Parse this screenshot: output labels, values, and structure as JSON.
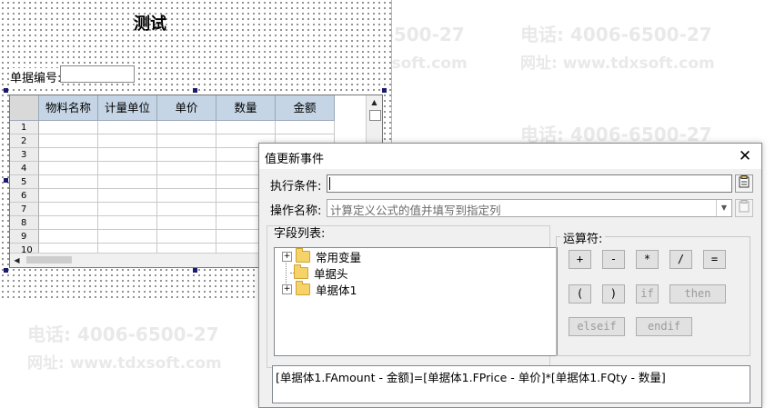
{
  "watermark": {
    "phone": "电话: 4006-6500-27",
    "website": "网址: www.tdxsoft.com"
  },
  "designer": {
    "title": "测试",
    "bill_no_label": "单据编号:",
    "bill_no_value": "",
    "grid": {
      "columns": [
        "物料名称",
        "计量单位",
        "单价",
        "数量",
        "金额"
      ],
      "row_numbers": [
        "1",
        "2",
        "3",
        "4",
        "5",
        "6",
        "7",
        "8",
        "9",
        "10"
      ]
    }
  },
  "dialog": {
    "title": "值更新事件",
    "close_glyph": "✕",
    "condition_label": "执行条件:",
    "condition_value": "",
    "operation_label": "操作名称:",
    "operation_value": "计算定义公式的值并填写到指定列",
    "fields_label": "字段列表:",
    "tree": [
      {
        "label": "常用变量",
        "expandable": true,
        "expand_glyph": "+"
      },
      {
        "label": "单据头",
        "expandable": false
      },
      {
        "label": "单据体1",
        "expandable": true,
        "expand_glyph": "+"
      }
    ],
    "operators_label": "运算符:",
    "operators": [
      "+",
      "-",
      "*",
      "/",
      "=",
      "(",
      ")",
      "if",
      "then",
      "elseif",
      "endif"
    ],
    "formula": "[单据体1.FAmount - 金额]=[单据体1.FPrice - 单价]*[单据体1.FQty - 数量]",
    "icons": [
      "clipboard-icon",
      "clipboard-disabled-icon",
      "folder-icon",
      "close-icon"
    ]
  }
}
